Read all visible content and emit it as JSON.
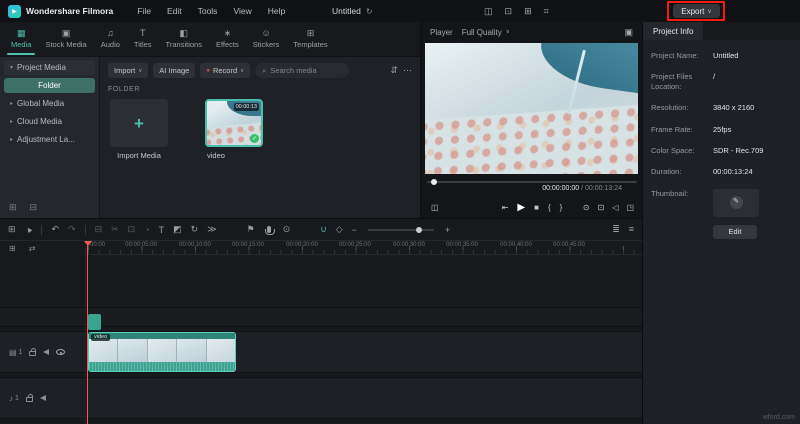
{
  "topbar": {
    "app_name": "Wondershare Filmora",
    "menus": [
      "File",
      "Edit",
      "Tools",
      "View",
      "Help"
    ],
    "project_title": "Untitled",
    "export_label": "Export"
  },
  "tabs": [
    {
      "label": "Media"
    },
    {
      "label": "Stock Media"
    },
    {
      "label": "Audio"
    },
    {
      "label": "Titles"
    },
    {
      "label": "Transitions"
    },
    {
      "label": "Effects"
    },
    {
      "label": "Stickers"
    },
    {
      "label": "Templates"
    }
  ],
  "sidebar": {
    "items": [
      "Project Media",
      "Folder",
      "Global Media",
      "Cloud Media",
      "Adjustment La..."
    ]
  },
  "library": {
    "import_label": "Import",
    "ai_image_label": "AI Image",
    "record_label": "Record",
    "search_placeholder": "Search media",
    "section_label": "FOLDER",
    "import_tile_label": "Import Media",
    "video_label": "video",
    "video_duration": "00:00:13"
  },
  "player": {
    "label": "Player",
    "quality": "Full Quality",
    "current_time": "00:00:00:00",
    "total_time": " / 00:00:13:24"
  },
  "project_info": {
    "tab_title": "Project Info",
    "fields": [
      {
        "label": "Project Name:",
        "value": "Untitled"
      },
      {
        "label": "Project Files Location:",
        "value": "/"
      },
      {
        "label": "Resolution:",
        "value": "3840 x 2160"
      },
      {
        "label": "Frame Rate:",
        "value": "25fps"
      },
      {
        "label": "Color Space:",
        "value": "SDR - Rec.709"
      },
      {
        "label": "Duration:",
        "value": "00:00:13:24"
      },
      {
        "label": "Thumbnail:",
        "value": ""
      }
    ],
    "edit_label": "Edit"
  },
  "timeline": {
    "ruler": [
      "00:00",
      "00:00:05:00",
      "00:00:10:00",
      "00:00:15:00",
      "00:00:20:00",
      "00:00:25:00",
      "00:00:30:00",
      "00:00:35:00",
      "00:00:40:00",
      "00:00:45:00"
    ],
    "clip_label": "video",
    "video_track": "1",
    "audio_track": "1"
  },
  "watermark": "wford.com",
  "colors": {
    "accent": "#4dbfae",
    "playhead": "#f4574d",
    "record_red": "#e0493e",
    "annotation": "#ee1c14"
  },
  "icons": {
    "logo": "▶",
    "status": "↻",
    "layout": "◫",
    "capture": "⊡",
    "grid": "⊞",
    "keyboard": "⌗",
    "chevron_down": "∨",
    "tab_media": "▦",
    "tab_stock": "▣",
    "tab_audio": "♫",
    "tab_titles": "T",
    "tab_transitions": "◧",
    "tab_effects": "∗",
    "tab_stickers": "☺",
    "tab_templates": "⊞",
    "chevron_expanded": "▾",
    "chevron_right": "▸",
    "add_folder": "⊞",
    "remove_folder": "⊟",
    "record_dot": "●",
    "search": "⌕",
    "filter": "⇵",
    "more": "⋯",
    "plus": "+",
    "check": "✓",
    "display": "▣",
    "compare": "◫",
    "step_back": "⇤",
    "play": "▶",
    "stop": "■",
    "mark_in": "{",
    "mark_out": "}",
    "snapshot": "⊙",
    "crop": "⊡",
    "volume": "◁",
    "fullscreen": "◳",
    "media_view": "⊞",
    "pointer": "▲",
    "undo": "↶",
    "redo": "↷",
    "trash": "⊟",
    "split": "✂",
    "crop_tool": "⊡",
    "speed": "◔",
    "text_tool": "T",
    "color_tool": "◩",
    "rotate": "↻",
    "more_tools": "≫",
    "marker": "⚑",
    "screen_record": "⊙",
    "snap": "∪",
    "keyframe": "◇",
    "zoom_out": "−",
    "zoom_in": "+",
    "track_options": "≣",
    "settings": "≡",
    "manage_tracks": "⊞",
    "link": "⇄",
    "video_track_icon": "▤",
    "audio_track_icon": "♪",
    "edit_pencil": "✎"
  }
}
